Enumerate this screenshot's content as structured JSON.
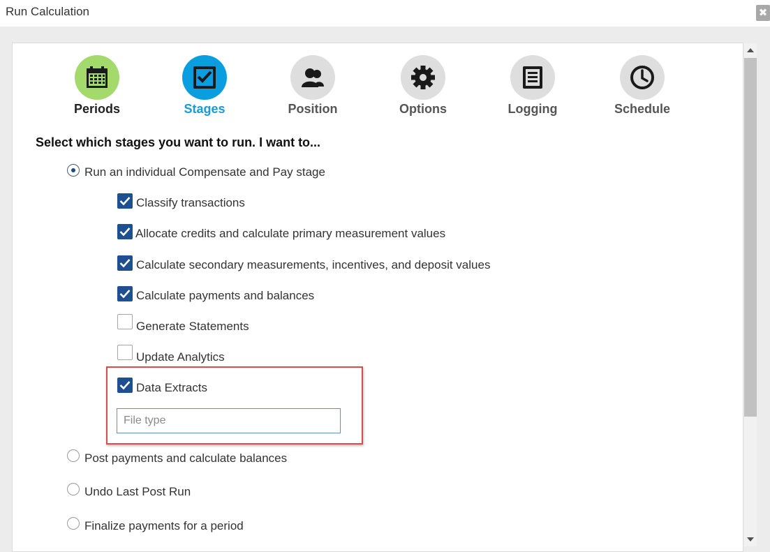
{
  "window": {
    "title": "Run Calculation",
    "close_icon": "close-icon"
  },
  "steps": [
    {
      "label": "Periods",
      "icon": "calendar-icon",
      "state": "done",
      "circle_color": "#a4d96c",
      "icon_color": "#1a1a1a",
      "label_color": "#222222"
    },
    {
      "label": "Stages",
      "icon": "checkbox-icon",
      "state": "active",
      "circle_color": "#0a9ee0",
      "icon_color": "#1a1a1a",
      "label_color": "#1a9ad8"
    },
    {
      "label": "Position",
      "icon": "people-icon",
      "state": "pending",
      "circle_color": "#dedede",
      "icon_color": "#1a1a1a",
      "label_color": "#555555"
    },
    {
      "label": "Options",
      "icon": "gear-icon",
      "state": "pending",
      "circle_color": "#dedede",
      "icon_color": "#1a1a1a",
      "label_color": "#555555"
    },
    {
      "label": "Logging",
      "icon": "document-icon",
      "state": "pending",
      "circle_color": "#dedede",
      "icon_color": "#1a1a1a",
      "label_color": "#555555"
    },
    {
      "label": "Schedule",
      "icon": "clock-icon",
      "state": "pending",
      "circle_color": "#dedede",
      "icon_color": "#1a1a1a",
      "label_color": "#555555"
    }
  ],
  "heading": "Select which stages you want to run. I want to...",
  "options": {
    "individual": {
      "label": "Run an individual Compensate and Pay stage",
      "selected": true
    },
    "post": {
      "label": "Post payments and calculate balances",
      "selected": false
    },
    "undo": {
      "label": "Undo Last Post Run",
      "selected": false
    },
    "finalize": {
      "label": "Finalize payments for a period",
      "selected": false
    }
  },
  "stages": [
    {
      "label": "Classify transactions",
      "checked": true
    },
    {
      "label": "Allocate credits and calculate primary measurement values",
      "checked": true
    },
    {
      "label": "Calculate secondary measurements, incentives, and deposit values",
      "checked": true
    },
    {
      "label": "Calculate payments and balances",
      "checked": true
    },
    {
      "label": "Generate Statements",
      "checked": false
    },
    {
      "label": "Update Analytics",
      "checked": false
    },
    {
      "label": "Data Extracts",
      "checked": true
    }
  ],
  "file_type": {
    "value": "",
    "placeholder": "File type"
  },
  "colors": {
    "checkbox_checked": "#1e4f91",
    "highlight_border": "#e04a4a",
    "input_border": "#5b8fd0"
  }
}
